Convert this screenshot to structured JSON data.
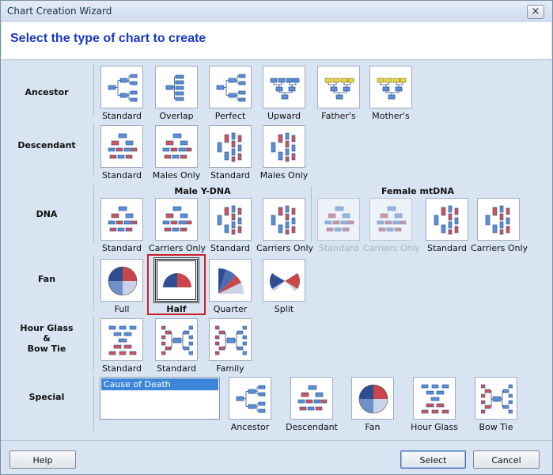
{
  "window": {
    "title": "Chart Creation Wizard",
    "close_glyph": "×"
  },
  "header": {
    "title": "Select the type of chart to create"
  },
  "rows": {
    "ancestor": {
      "label": "Ancestor",
      "tiles": [
        "Standard",
        "Overlap",
        "Perfect",
        "Upward",
        "Father's",
        "Mother's"
      ]
    },
    "descendant": {
      "label": "Descendant",
      "tiles": [
        "Standard",
        "Males Only",
        "Standard",
        "Males Only"
      ]
    },
    "dna": {
      "label": "DNA",
      "male_group": "Male Y-DNA",
      "female_group": "Female mtDNA",
      "tiles": [
        "Standard",
        "Carriers Only",
        "Standard",
        "Carriers Only",
        "Standard",
        "Carriers Only",
        "Standard",
        "Carriers Only"
      ]
    },
    "fan": {
      "label": "Fan",
      "tiles": [
        "Full",
        "Half",
        "Quarter",
        "Split"
      ],
      "selected": "Half"
    },
    "hourglass": {
      "label_line1": "Hour Glass",
      "label_line2": "&",
      "label_line3": "Bow Tie",
      "tiles": [
        "Standard",
        "Standard",
        "Family"
      ]
    },
    "special": {
      "label": "Special",
      "list_items": [
        "Cause of Death"
      ],
      "tiles": [
        "Ancestor",
        "Descendant",
        "Fan",
        "Hour Glass",
        "Bow Tie"
      ]
    }
  },
  "footer": {
    "help": "Help",
    "select": "Select",
    "cancel": "Cancel"
  },
  "colors": {
    "accent_blue": "#1a39c4",
    "selection_red": "#c8202a",
    "fan_red": "#c7474a",
    "fan_blue": "#2f4e8f"
  }
}
